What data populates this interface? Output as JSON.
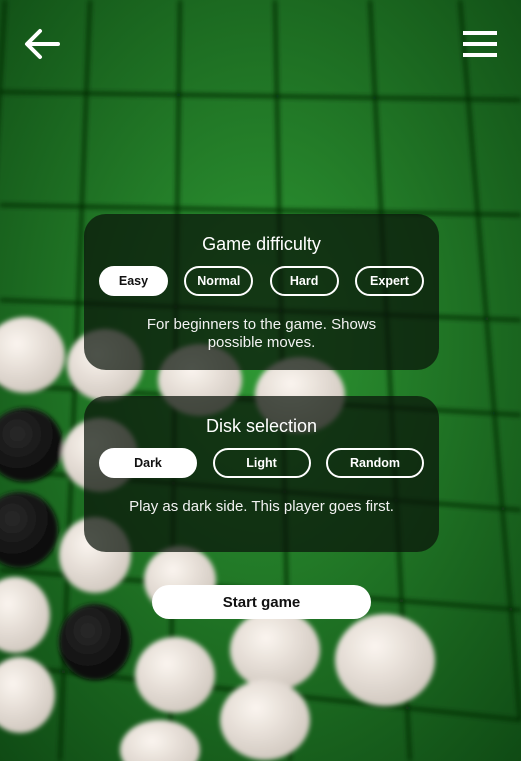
{
  "nav": {
    "back_icon": "arrow-left-icon",
    "menu_icon": "hamburger-menu-icon"
  },
  "difficulty": {
    "title": "Game difficulty",
    "options": [
      "Easy",
      "Normal",
      "Hard",
      "Expert"
    ],
    "selected": "Easy",
    "description": "For beginners to the game. Shows possible moves."
  },
  "disk": {
    "title": "Disk selection",
    "options": [
      "Dark",
      "Light",
      "Random"
    ],
    "selected": "Dark",
    "description": "Play as dark side. This player goes first."
  },
  "start_label": "Start game",
  "colors": {
    "board": "#1f7a24",
    "panel": "rgba(10,20,10,0.72)",
    "accent": "#ffffff"
  }
}
